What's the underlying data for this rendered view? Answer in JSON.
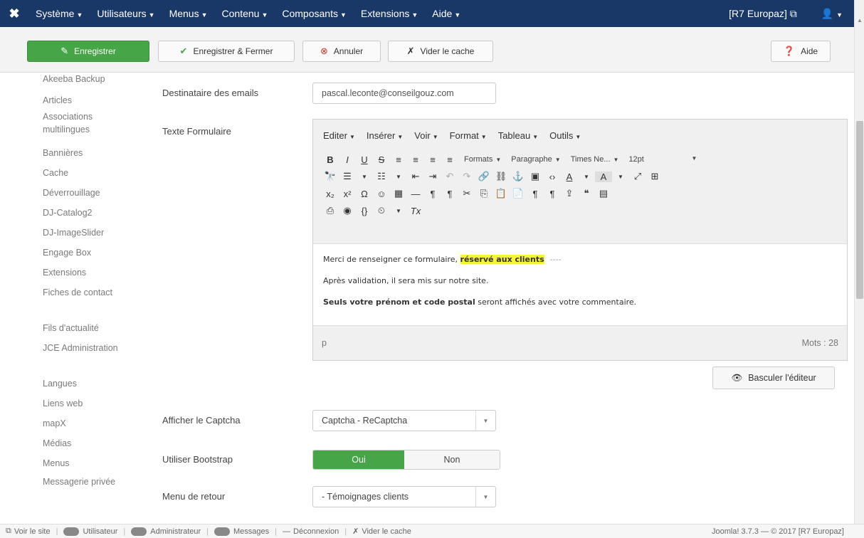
{
  "navbar": {
    "logo_icon": "joomla-logo-icon",
    "menu": [
      {
        "label": "Système"
      },
      {
        "label": "Utilisateurs"
      },
      {
        "label": "Menus"
      },
      {
        "label": "Contenu"
      },
      {
        "label": "Composants"
      },
      {
        "label": "Extensions"
      },
      {
        "label": "Aide"
      }
    ],
    "site_label": "[R7 Europaz]",
    "site_icon": "external-link-icon",
    "user_icon": "user-icon"
  },
  "toolbar": {
    "save": "Enregistrer",
    "save_close": "Enregistrer & Fermer",
    "cancel": "Annuler",
    "clear_cache": "Vider le cache",
    "help": "Aide",
    "colors": {
      "green": "#46a546",
      "cancel_icon": "#c0392b"
    }
  },
  "sidebar": {
    "items": [
      {
        "label": "Akeeba Backup"
      },
      {
        "label": "Articles"
      },
      {
        "label": "Associations multilingues"
      },
      {
        "label": "Bannières"
      },
      {
        "label": "Cache"
      },
      {
        "label": "Déverrouillage"
      },
      {
        "label": "DJ-Catalog2"
      },
      {
        "label": "DJ-ImageSlider"
      },
      {
        "label": "Engage Box"
      },
      {
        "label": "Extensions"
      },
      {
        "label": "Fiches de contact"
      },
      {
        "label": "Fils d'actualité"
      },
      {
        "label": "JCE Administration"
      },
      {
        "label": "Langues"
      },
      {
        "label": "Liens web"
      },
      {
        "label": "mapX"
      },
      {
        "label": "Médias"
      },
      {
        "label": "Menus"
      },
      {
        "label": "Messagerie privée"
      }
    ]
  },
  "form": {
    "email_label": "Destinataire des emails",
    "email_value": "pascal.leconte@conseilgouz.com",
    "text_label": "Texte Formulaire",
    "captcha_label": "Afficher le Captcha",
    "captcha_value": "Captcha - ReCaptcha",
    "bootstrap_label": "Utiliser Bootstrap",
    "bootstrap_on": "Oui",
    "bootstrap_off": "Non",
    "return_label": "Menu de retour",
    "return_value": "- Témoignages clients"
  },
  "editor": {
    "menubar": [
      "Editer",
      "Insérer",
      "Voir",
      "Format",
      "Tableau",
      "Outils"
    ],
    "formats_dd": "Formats",
    "paragraph_dd": "Paragraphe",
    "font_dd": "Times Ne...",
    "size_dd": "12pt",
    "content": {
      "line1_a": "Merci de renseigner ce formulaire, ",
      "line1_hl": "réservé aux clients",
      "line1_dash": "----",
      "line2": "Après validation, il sera mis sur notre site.",
      "line3_b": "Seuls votre prénom et code postal",
      "line3_rest": " seront affichés avec votre commentaire."
    },
    "path": "p",
    "word_count": "Mots : 28",
    "toggle_button": "Basculer l'éditeur"
  },
  "statusbar": {
    "view_site": "Voir le site",
    "users": "Utilisateur",
    "admins": "Administrateur",
    "messages": "Messages",
    "logout": "Déconnexion",
    "clear_cache": "Vider le cache",
    "version": "Joomla! 3.7.3 — © 2017 [R7 Europaz]"
  }
}
